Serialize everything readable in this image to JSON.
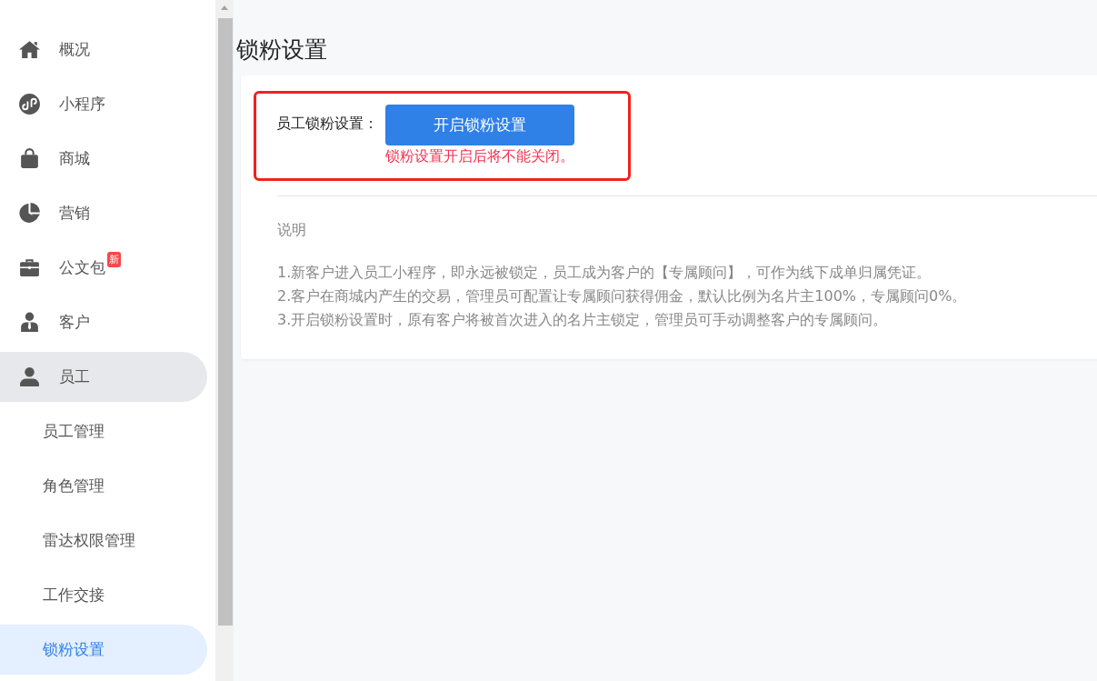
{
  "sidebar": {
    "items": [
      {
        "label": "概况",
        "kind": "home",
        "selected": false
      },
      {
        "label": "小程序",
        "kind": "mini",
        "selected": false
      },
      {
        "label": "商城",
        "kind": "bag",
        "selected": false
      },
      {
        "label": "营销",
        "kind": "pie",
        "selected": false
      },
      {
        "label": "公文包",
        "kind": "briefcase",
        "badge": "新",
        "selected": false
      },
      {
        "label": "客户",
        "kind": "customer",
        "selected": false
      },
      {
        "label": "员工",
        "kind": "person",
        "selected": false,
        "expanded": true,
        "children": [
          {
            "label": "员工管理",
            "selected": false
          },
          {
            "label": "角色管理",
            "selected": false
          },
          {
            "label": "雷达权限管理",
            "selected": false
          },
          {
            "label": "工作交接",
            "selected": false
          },
          {
            "label": "锁粉设置",
            "selected": true
          }
        ]
      }
    ]
  },
  "page": {
    "title": "锁粉设置",
    "setting": {
      "label": "员工锁粉设置：",
      "button": "开启锁粉设置",
      "warning": "锁粉设置开启后将不能关闭。"
    },
    "notes": {
      "heading": "说明",
      "lines": [
        "1.新客户进入员工小程序，即永远被锁定，员工成为客户的【专属顾问】，可作为线下成单归属凭证。",
        "2.客户在商城内产生的交易，管理员可配置让专属顾问获得佣金，默认比例为名片主100%，专属顾问0%。",
        "3.开启锁粉设置时，原有客户将被首次进入的名片主锁定，管理员可手动调整客户的专属顾问。"
      ]
    }
  }
}
